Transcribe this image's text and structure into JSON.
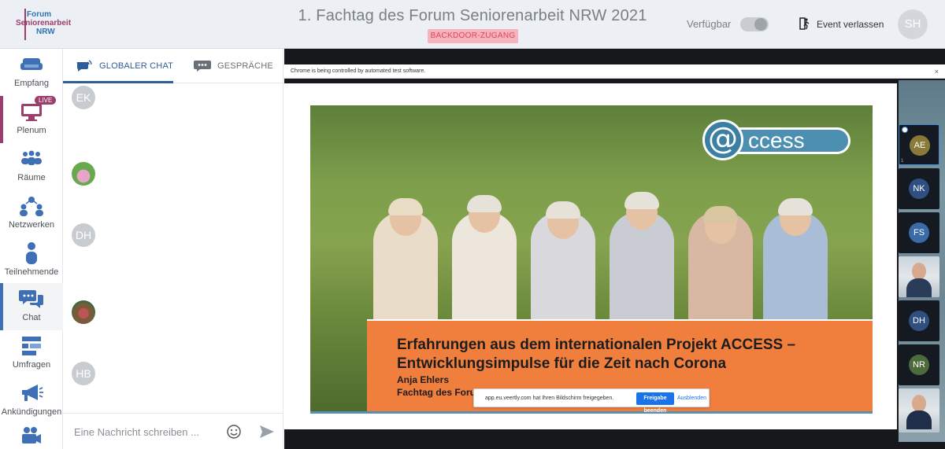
{
  "header": {
    "logo": {
      "line1": "Forum",
      "line2": "Seniorenarbeit",
      "line3": "NRW"
    },
    "event_title": "1. Fachtag des Forum Seniorenarbeit NRW 2021",
    "backdoor_badge": "BACKDOOR-ZUGANG",
    "availability_label": "Verfügbar",
    "availability_on": false,
    "leave_label": "Event verlassen",
    "user_initials": "SH"
  },
  "sidebar": {
    "items": [
      {
        "label": "Empfang",
        "icon": "sofa-icon"
      },
      {
        "label": "Plenum",
        "icon": "monitor-icon",
        "badge": "LIVE"
      },
      {
        "label": "Räume",
        "icon": "group-icon"
      },
      {
        "label": "Netzwerken",
        "icon": "network-icon"
      },
      {
        "label": "Teilnehmende",
        "icon": "person-icon"
      },
      {
        "label": "Chat",
        "icon": "chat-bubbles-icon",
        "active": true
      },
      {
        "label": "Umfragen",
        "icon": "poll-icon"
      },
      {
        "label": "Ankündigungen",
        "icon": "megaphone-icon"
      },
      {
        "label": "",
        "icon": "video-camera-icon"
      }
    ]
  },
  "chat": {
    "tabs": [
      {
        "label": "GLOBALER CHAT",
        "icon": "global-chat-icon",
        "active": true
      },
      {
        "label": "GESPRÄCHE",
        "icon": "conversation-icon",
        "active": false
      }
    ],
    "messages": [
      {
        "avatar_initials": "EK"
      },
      {
        "avatar_initials": ""
      },
      {
        "avatar_initials": "DH"
      },
      {
        "avatar_initials": ""
      },
      {
        "avatar_initials": "HB"
      }
    ],
    "composer_placeholder": "Eine Nachricht schreiben ..."
  },
  "stage": {
    "automation_notice": "Chrome is being controlled by automated test software.",
    "close_glyph": "×",
    "slide": {
      "logo_text": "ccess",
      "logo_at": "@",
      "title_line1": "Erfahrungen aus dem internationalen Projekt ACCESS –",
      "title_line2": "Entwicklungsimpulse für die Zeit nach Corona",
      "speaker": "Anja Ehlers",
      "event_line": "Fachtag des Forum Seniorenarbeit NRW, 20. Juli 2021"
    },
    "share_notice": {
      "text": "app.eu.veertly.com hat Ihren Bildschirm freigegeben.",
      "stop_label": "Freigabe beenden",
      "hide_label": "Ausblenden"
    },
    "participants": [
      {
        "initials": "AE",
        "color": "#8a7a3a",
        "selected": true
      },
      {
        "initials": "NK",
        "color": "#2f4f80"
      },
      {
        "initials": "FS",
        "color": "#3b6aa8"
      },
      {
        "initials": "",
        "video": true
      },
      {
        "initials": "DH",
        "color": "#2f4f80"
      },
      {
        "initials": "NR",
        "color": "#4d6a3a"
      },
      {
        "initials": "",
        "video": true
      }
    ]
  },
  "colors": {
    "brand_blue": "#2f74b5",
    "brand_plum": "#9c3e6d",
    "nav_icon_blue": "#3f6fb5",
    "slide_orange": "#f07f3e"
  }
}
